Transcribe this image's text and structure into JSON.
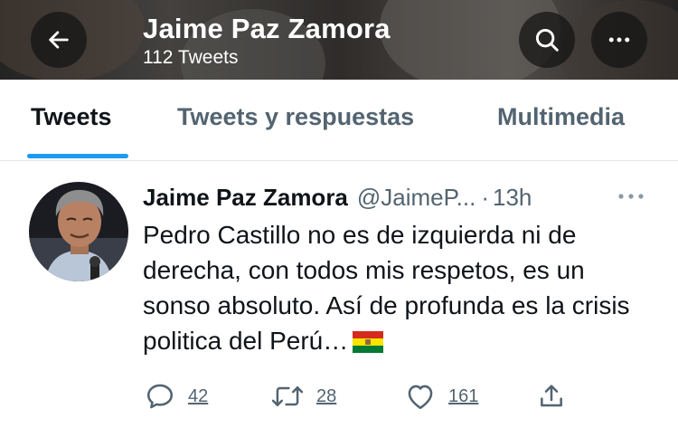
{
  "header": {
    "title": "Jaime Paz Zamora",
    "subtitle": "112 Tweets",
    "back_icon": "arrow-left-icon",
    "search_icon": "search-icon",
    "more_icon": "more-horizontal-icon"
  },
  "tabs": [
    {
      "label": "Tweets",
      "active": true
    },
    {
      "label": "Tweets y respuestas",
      "active": false
    },
    {
      "label": "Multimedia",
      "active": false
    }
  ],
  "tweet": {
    "author_name": "Jaime Paz Zamora",
    "author_handle": "@JaimeP...",
    "separator": "·",
    "time": "13h",
    "text": "Pedro Castillo no es de izquierda ni de derecha, con todos mis respetos, es un sonso absoluto. Así de profunda es la crisis politica del Perú…",
    "emoji": "bolivia-flag",
    "actions": {
      "reply_count": "42",
      "retweet_count": "28",
      "like_count": "161"
    }
  },
  "colors": {
    "accent": "#1d9bf0",
    "text_primary": "#0f1419",
    "text_secondary": "#536471"
  }
}
